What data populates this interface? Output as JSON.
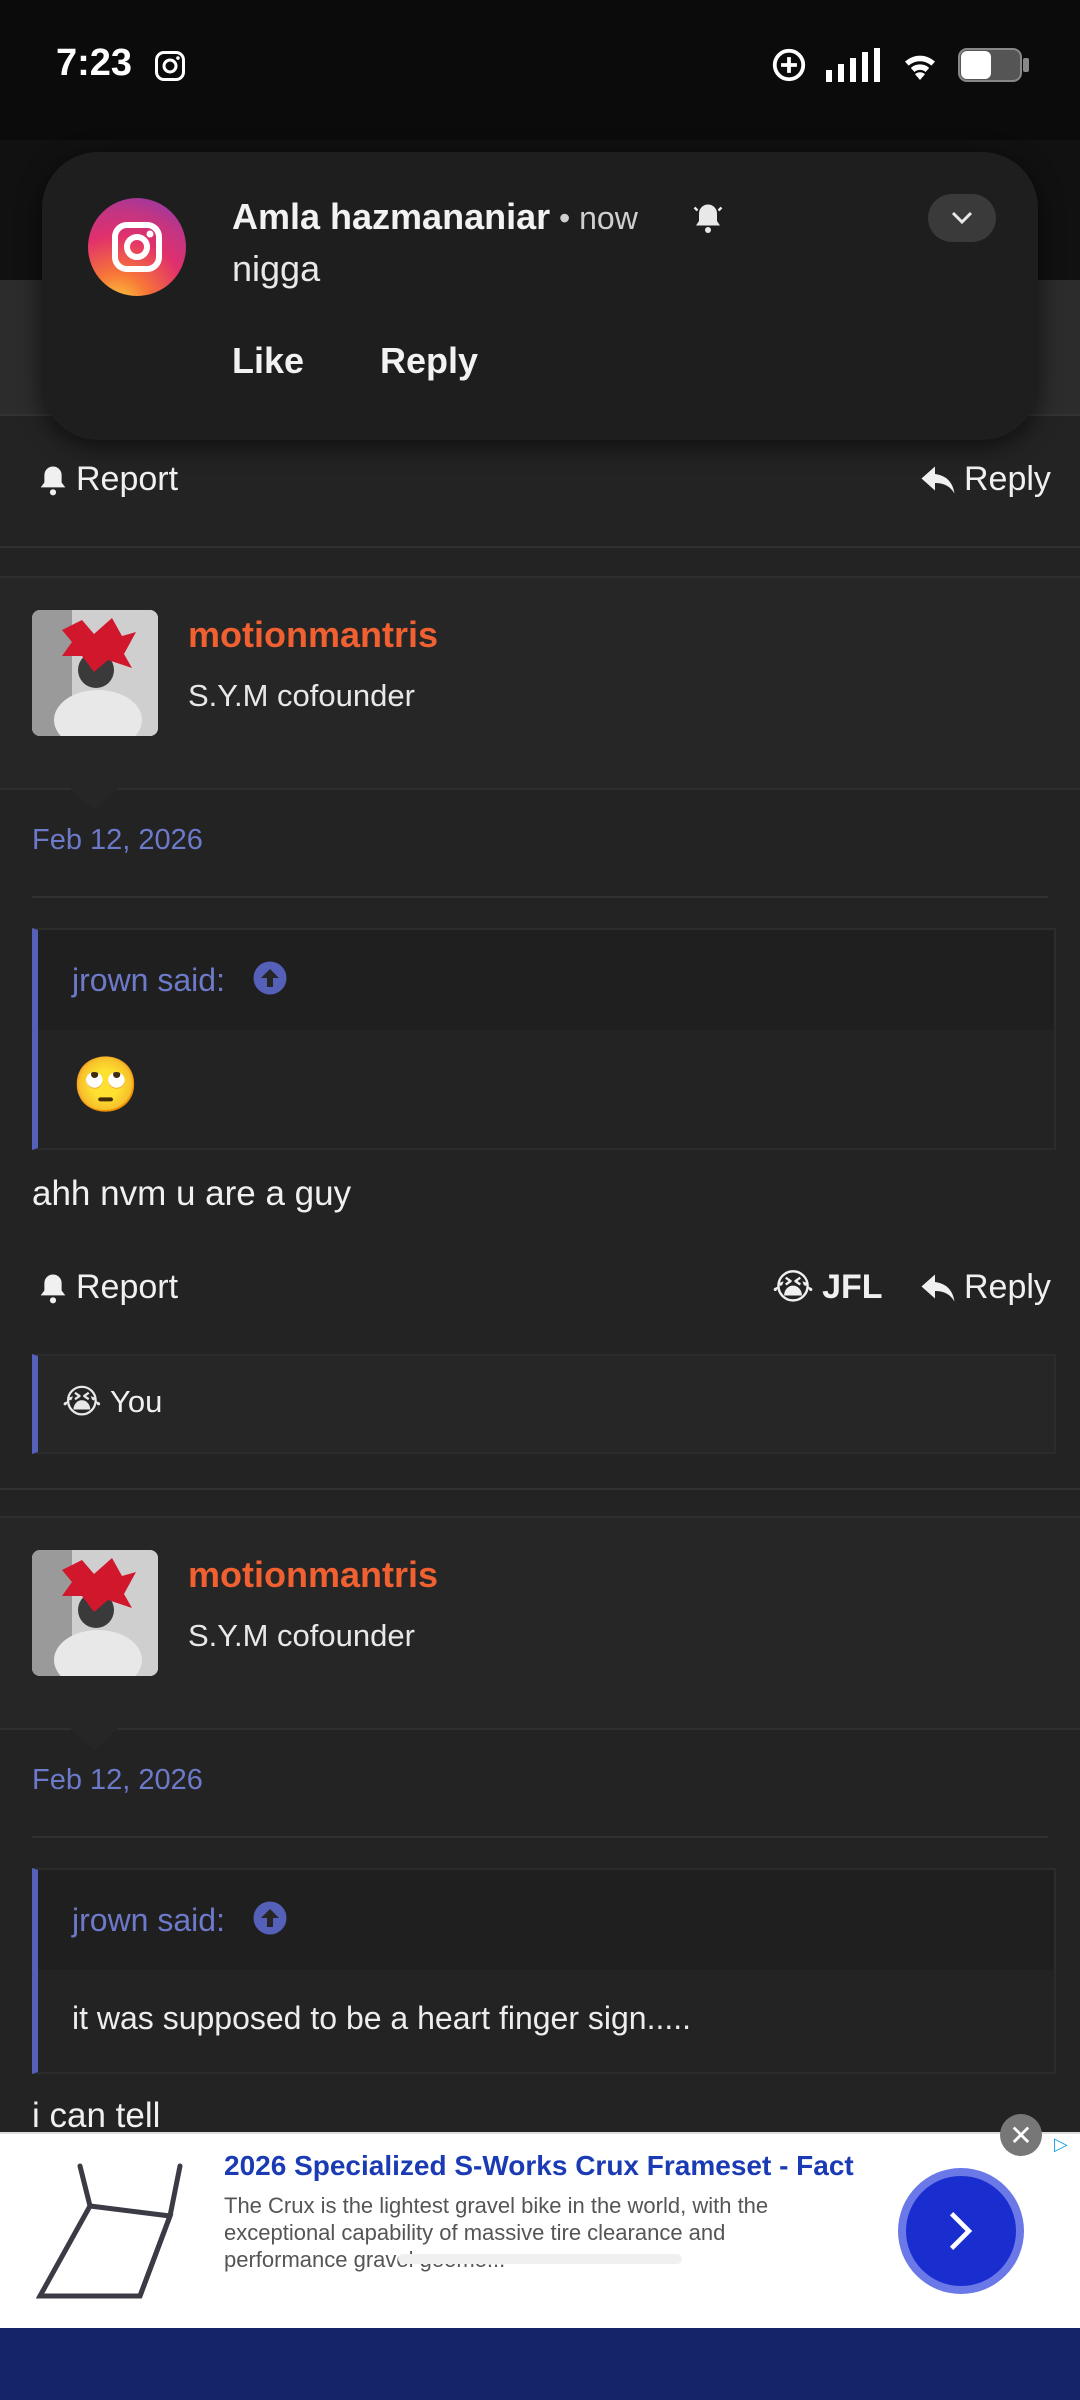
{
  "status_bar": {
    "time": "7:23"
  },
  "notification": {
    "sender": "Amla hazmananiar",
    "meta": " • now",
    "message": "nigga",
    "actions": {
      "like": "Like",
      "reply": "Reply"
    }
  },
  "post_actions_top": {
    "report": "Report",
    "reply": "Reply"
  },
  "posts": [
    {
      "username": "motionmantris",
      "user_title": "S.Y.M cofounder",
      "date": "Feb 12, 2026",
      "quote_author": "jrown said:",
      "quote_text": "🙄",
      "text": "ahh nvm u are a guy",
      "actions": {
        "report": "Report",
        "reaction": "JFL",
        "reply": "Reply"
      },
      "reactions": {
        "emoji": "😭",
        "label": "You"
      }
    },
    {
      "username": "motionmantris",
      "user_title": "S.Y.M cofounder",
      "date": "Feb 12, 2026",
      "quote_author": "jrown said:",
      "quote_text": "it was supposed to be a heart finger sign.....",
      "text": "i can tell"
    }
  ],
  "ad": {
    "title": "2026 Specialized S-Works Crux Frameset - Fact",
    "description": "The Crux is the lightest gravel bike in the world, with the exceptional capability of massive tire clearance and performance gravel geome..."
  },
  "colors": {
    "username": "#f06030",
    "accent": "#5561b8",
    "date": "#6d79c9"
  }
}
